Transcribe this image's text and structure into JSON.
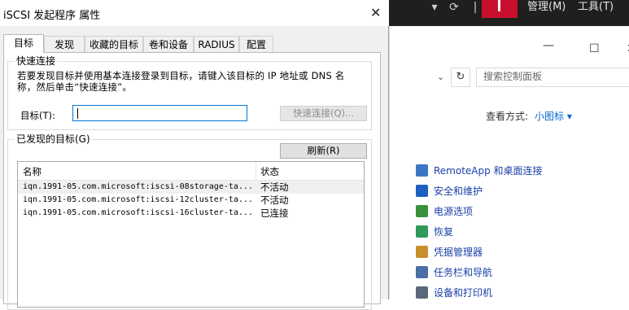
{
  "dialog": {
    "title": "iSCSI 发起程序 属性",
    "tabs": [
      {
        "label": "目标",
        "active": true
      },
      {
        "label": "发现"
      },
      {
        "label": "收藏的目标"
      },
      {
        "label": "卷和设备"
      },
      {
        "label": "RADIUS"
      },
      {
        "label": "配置"
      }
    ],
    "quick_connect": {
      "legend": "快速连接",
      "description": "若要发现目标并使用基本连接登录到目标，请键入该目标的 IP 地址或 DNS 名称，然后单击“快速连接”。",
      "target_label": "目标(T):",
      "target_value": "",
      "quick_connect_button": "快速连接(Q)..."
    },
    "discovered": {
      "legend": "已发现的目标(G)",
      "refresh_button": "刷新(R)",
      "columns": [
        "名称",
        "状态"
      ],
      "rows": [
        {
          "name": "iqn.1991-05.com.microsoft:iscsi-08storage-ta...",
          "status": "不活动"
        },
        {
          "name": "iqn.1991-05.com.microsoft:iscsi-12cluster-ta...",
          "status": "不活动"
        },
        {
          "name": "iqn.1991-05.com.microsoft:iscsi-16cluster-ta...",
          "status": "已连接"
        }
      ]
    }
  },
  "background": {
    "menu_items": [
      "管理(M)",
      "工具(T)"
    ],
    "search_placeholder": "搜索控制面板",
    "view_label": "查看方式:",
    "view_value": "小图标 ▾",
    "items": [
      {
        "label": "RemoteApp 和桌面连接",
        "color": "#3a78c3"
      },
      {
        "label": "安全和维护",
        "color": "#1f5fbf"
      },
      {
        "label": "电源选项",
        "color": "#3a8f3a"
      },
      {
        "label": "恢复",
        "color": "#2e9a5a"
      },
      {
        "label": "凭据管理器",
        "color": "#c8902a"
      },
      {
        "label": "任务栏和导航",
        "color": "#4a6fa5"
      },
      {
        "label": "设备和打印机",
        "color": "#5a6a7a"
      }
    ]
  }
}
